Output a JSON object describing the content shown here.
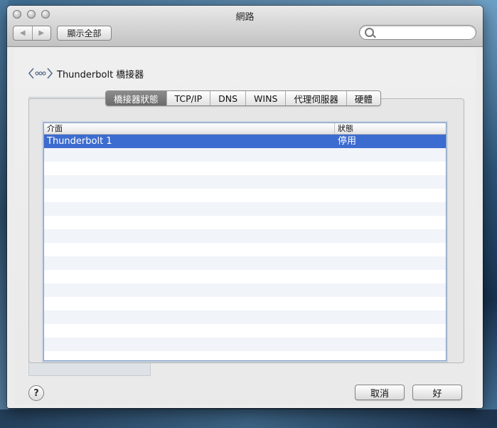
{
  "window": {
    "title": "網路"
  },
  "toolbar": {
    "back_icon": "◀",
    "forward_icon": "▶",
    "show_all": "顯示全部",
    "search_placeholder": ""
  },
  "panel": {
    "title": "Thunderbolt 橋接器"
  },
  "tabs": [
    {
      "label": "橋接器狀態",
      "active": true
    },
    {
      "label": "TCP/IP"
    },
    {
      "label": "DNS"
    },
    {
      "label": "WINS"
    },
    {
      "label": "代理伺服器"
    },
    {
      "label": "硬體"
    }
  ],
  "table": {
    "columns": [
      "介面",
      "狀態"
    ],
    "rows": [
      {
        "interface": "Thunderbolt 1",
        "status": "停用"
      }
    ]
  },
  "buttons": {
    "help": "?",
    "cancel": "取消",
    "ok": "好"
  },
  "colors": {
    "selection": "#3d6cd0",
    "active_tab": "#7a7a7a"
  }
}
